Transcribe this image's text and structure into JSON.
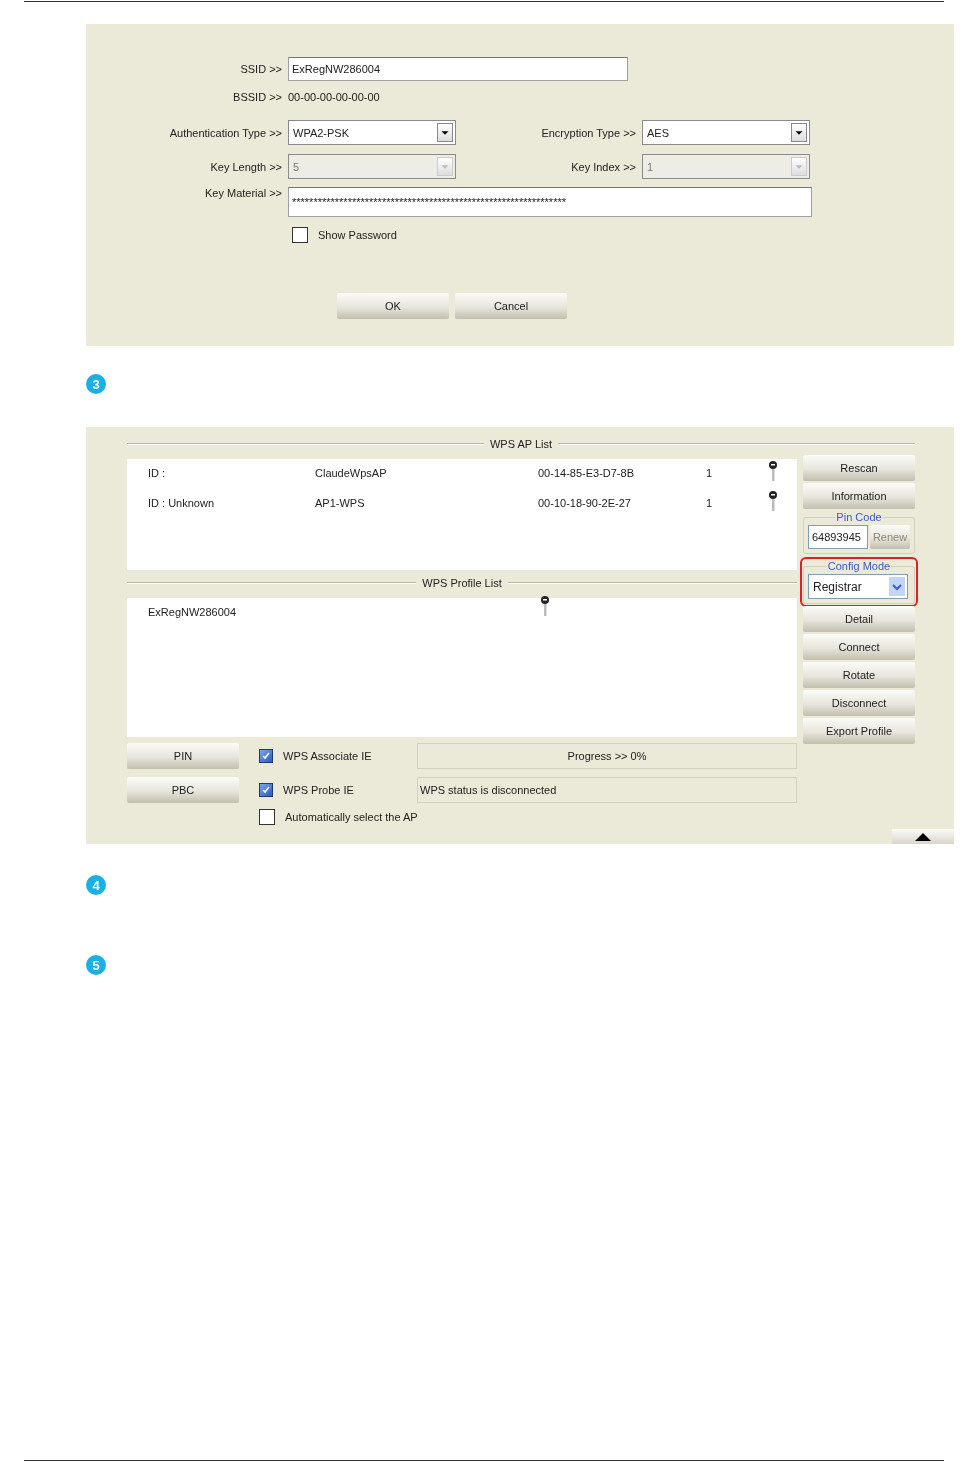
{
  "profile_dialog": {
    "ssid": {
      "label": "SSID >>",
      "value": "ExRegNW286004"
    },
    "bssid": {
      "label": "BSSID >>",
      "value": "00-00-00-00-00-00"
    },
    "authentication_type": {
      "label": "Authentication Type >>",
      "value": "WPA2-PSK",
      "disabled": false
    },
    "encryption_type": {
      "label": "Encryption Type >>",
      "value": "AES",
      "disabled": false
    },
    "key_length": {
      "label": "Key Length >>",
      "value": "5",
      "disabled": true
    },
    "key_index": {
      "label": "Key Index >>",
      "value": "1",
      "disabled": true
    },
    "key_material": {
      "label": "Key Material >>",
      "value": "****************************************************************"
    },
    "show_password": {
      "label": "Show Password",
      "checked": false
    },
    "buttons": [
      "OK",
      "Cancel"
    ]
  },
  "step_markers": [
    "3",
    "4",
    "5"
  ],
  "wps_window": {
    "ap_list": {
      "title": "WPS AP List",
      "rows": [
        {
          "id": "ID :",
          "ssid": "ClaudeWpsAP",
          "bssid": "00-14-85-E3-D7-8B",
          "channel": "1"
        },
        {
          "id": "ID : Unknown",
          "ssid": "AP1-WPS",
          "bssid": "00-10-18-90-2E-27",
          "channel": "1"
        }
      ]
    },
    "profile_list": {
      "title": "WPS Profile List",
      "rows": [
        {
          "name": "ExRegNW286004"
        }
      ]
    },
    "top_buttons": [
      "Rescan",
      "Information"
    ],
    "pin_code": {
      "title": "Pin Code",
      "value": "64893945",
      "renew": {
        "label": "Renew",
        "disabled": true
      }
    },
    "config_mode": {
      "title": "Config Mode",
      "value": "Registrar",
      "highlighted": true
    },
    "side_buttons": [
      "Detail",
      "Connect",
      "Rotate",
      "Disconnect",
      "Export Profile"
    ],
    "pin_button": "PIN",
    "pbc_button": "PBC",
    "options": [
      {
        "label": "WPS Associate IE",
        "checked": true
      },
      {
        "label": "WPS Probe IE",
        "checked": true
      },
      {
        "label": "Automatically select the AP",
        "checked": false
      }
    ],
    "progress": {
      "text": "Progress >> 0%"
    },
    "status": "WPS status is disconnected"
  }
}
